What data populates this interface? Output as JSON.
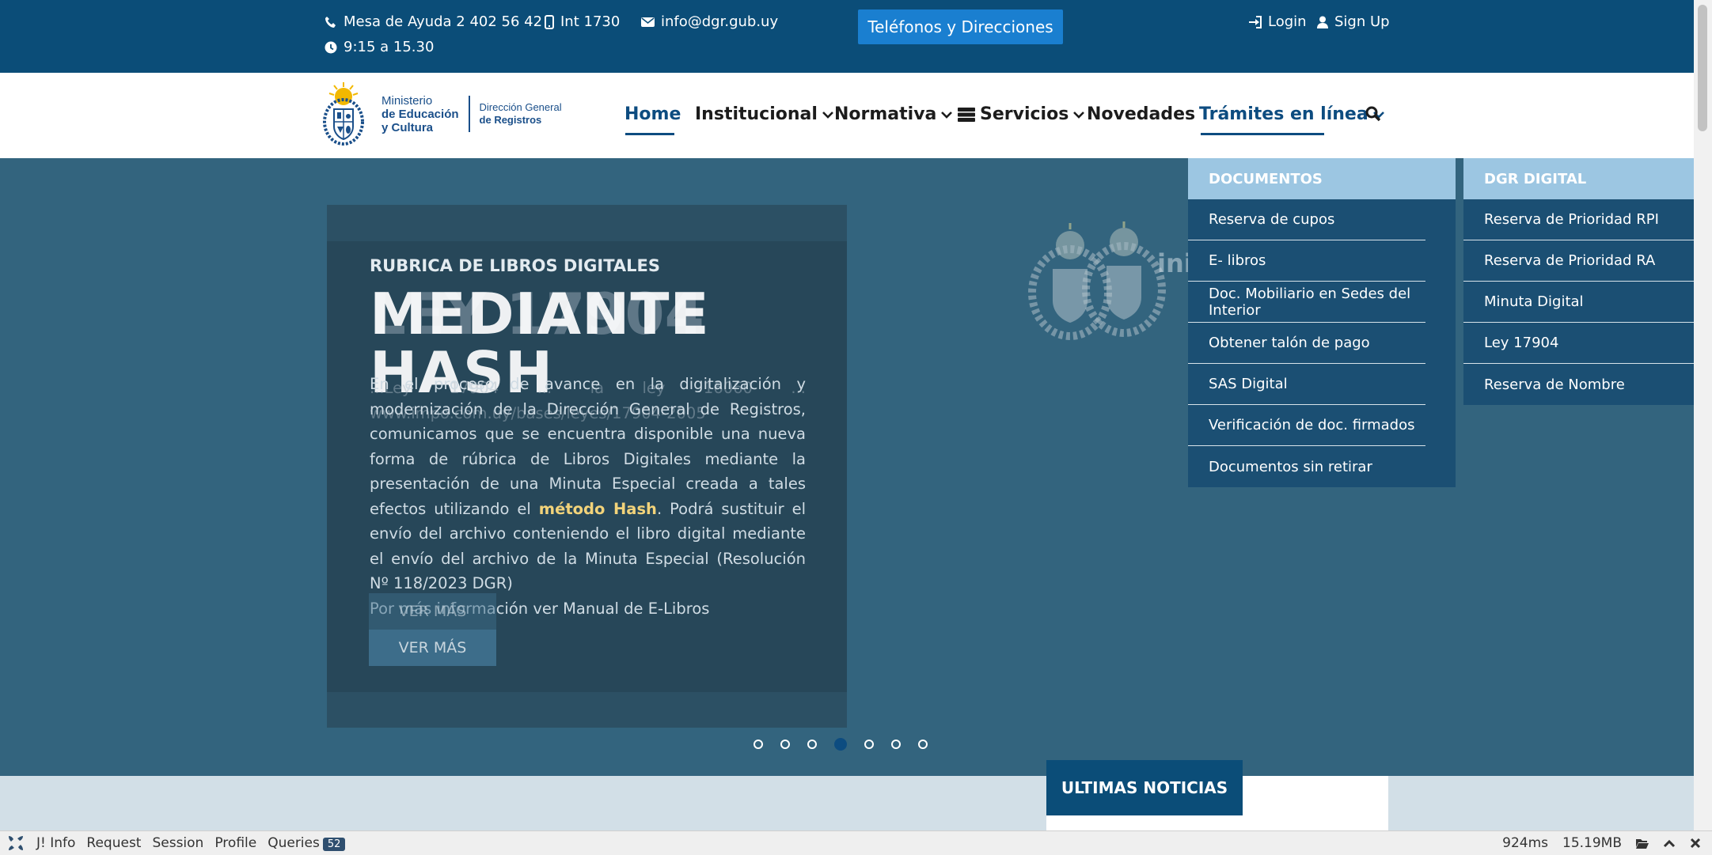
{
  "topbar": {
    "helpdesk": "Mesa de Ayuda 2 402 56 42",
    "internal": "Int 1730",
    "email": "info@dgr.gub.uy",
    "hours": "9:15 a 15.30",
    "phones_button": "Teléfonos y Direcciones",
    "login": "Login",
    "signup": "Sign Up"
  },
  "logo": {
    "ministry_line1": "Ministerio",
    "ministry_line2": "de Educación",
    "ministry_line3": "y Cultura",
    "dgr_line1": "Dirección General",
    "dgr_line2": "de Registros"
  },
  "nav": {
    "home": "Home",
    "institucional": "Institucional",
    "normativa": "Normativa",
    "servicios": "Servicios",
    "novedades": "Novedades",
    "tramites": "Trámites en línea"
  },
  "hero": {
    "kicker": "RUBRICA DE LIBROS DIGITALES",
    "title": "MEDIANTE HASH",
    "ghost_title": "LEY 17904",
    "body_intro": "En el proceso de avance en la digitalización y modernización de la Dirección General de Registros, comunicamos que se encuentra disponible una nueva forma de rúbrica de Libros Digitales mediante la presentación de una Minuta Especial creada a tales efectos utilizando el ",
    "body_highlight": "método Hash",
    "body_rest": ". Podrá sustituir el envío del archivo conteniendo el libro digital mediante el envío del archivo de la Minuta Especial (Resolución Nº 118/2023 DGR)",
    "body_more": "Por más información ver Manual de E-Libros",
    "ghost_body": "...Ley 17904 ... la ley 16060 ... www.impo.com.uy/bases/leyes/17904-2005",
    "more_button": "VER MÁS",
    "ghost_more_button": "VER MÁS",
    "watermark_text": "ini Cu",
    "slides_total": 7,
    "active_slide": 4
  },
  "dropdown": {
    "documentos": {
      "heading": "DOCUMENTOS",
      "items": [
        "Reserva de cupos",
        "E- libros",
        "Doc. Mobiliario en Sedes del Interior",
        "Obtener talón de pago",
        "SAS Digital",
        "Verificación de doc. firmados",
        "Documentos sin retirar"
      ]
    },
    "dgr_digital": {
      "heading": "DGR DIGITAL",
      "items": [
        "Reserva de Prioridad RPI",
        "Reserva de Prioridad RA",
        "Minuta Digital",
        "Ley 17904",
        "Reserva de Nombre"
      ]
    }
  },
  "news": {
    "tab": "ULTIMAS NOTICIAS"
  },
  "debugbar": {
    "info": "J! Info",
    "request": "Request",
    "session": "Session",
    "profile": "Profile",
    "queries": "Queries",
    "queries_count": "52",
    "time": "924ms",
    "memory": "15.19MB"
  },
  "colors": {
    "topbar": "#0b4d78",
    "hero": "#33647e",
    "accent": "#1a7fd0",
    "dropdown": "#1b4f73",
    "dropdown_head": "#9cc6e2"
  }
}
